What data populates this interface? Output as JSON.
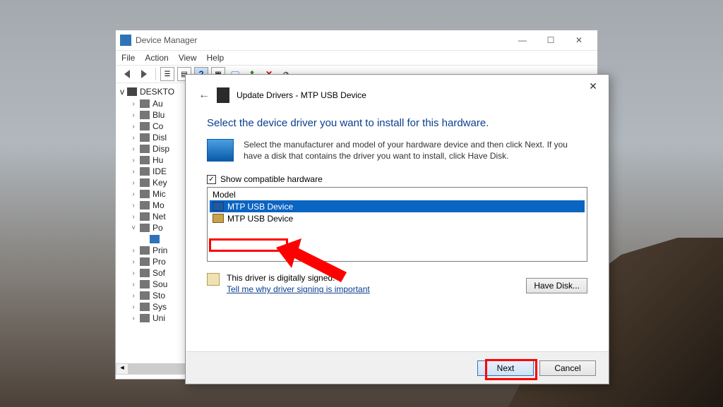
{
  "dm": {
    "title": "Device Manager",
    "menu": [
      "File",
      "Action",
      "View",
      "Help"
    ],
    "root": "DESKTO",
    "nodes": [
      {
        "label": "Au",
        "expand": ">"
      },
      {
        "label": "Blu",
        "expand": ">"
      },
      {
        "label": "Co",
        "expand": ">"
      },
      {
        "label": "Disl",
        "expand": ">"
      },
      {
        "label": "Disp",
        "expand": ">"
      },
      {
        "label": "Hu",
        "expand": ">"
      },
      {
        "label": "IDE",
        "expand": ">"
      },
      {
        "label": "Key",
        "expand": ">"
      },
      {
        "label": "Mic",
        "expand": ">"
      },
      {
        "label": "Mo",
        "expand": ">"
      },
      {
        "label": "Net",
        "expand": ">"
      },
      {
        "label": "Po",
        "expand": "v",
        "child": ""
      },
      {
        "label": "Prin",
        "expand": ">"
      },
      {
        "label": "Pro",
        "expand": ">"
      },
      {
        "label": "Sof",
        "expand": ">"
      },
      {
        "label": "Sou",
        "expand": ">"
      },
      {
        "label": "Sto",
        "expand": ">"
      },
      {
        "label": "Sys",
        "expand": ">"
      },
      {
        "label": "Uni",
        "expand": ">"
      }
    ]
  },
  "dlg": {
    "title": "Update Drivers - MTP USB Device",
    "heading": "Select the device driver you want to install for this hardware.",
    "intro": "Select the manufacturer and model of your hardware device and then click Next. If you have a disk that contains the driver you want to install, click Have Disk.",
    "checkbox_label": "Show compatible hardware",
    "checkbox_checked": "✓",
    "model_header": "Model",
    "models": [
      "MTP USB Device",
      "MTP USB Device"
    ],
    "signed_text": "This driver is digitally signed.",
    "signed_link": "Tell me why driver signing is important",
    "have_disk": "Have Disk...",
    "next": "Next",
    "cancel": "Cancel"
  }
}
